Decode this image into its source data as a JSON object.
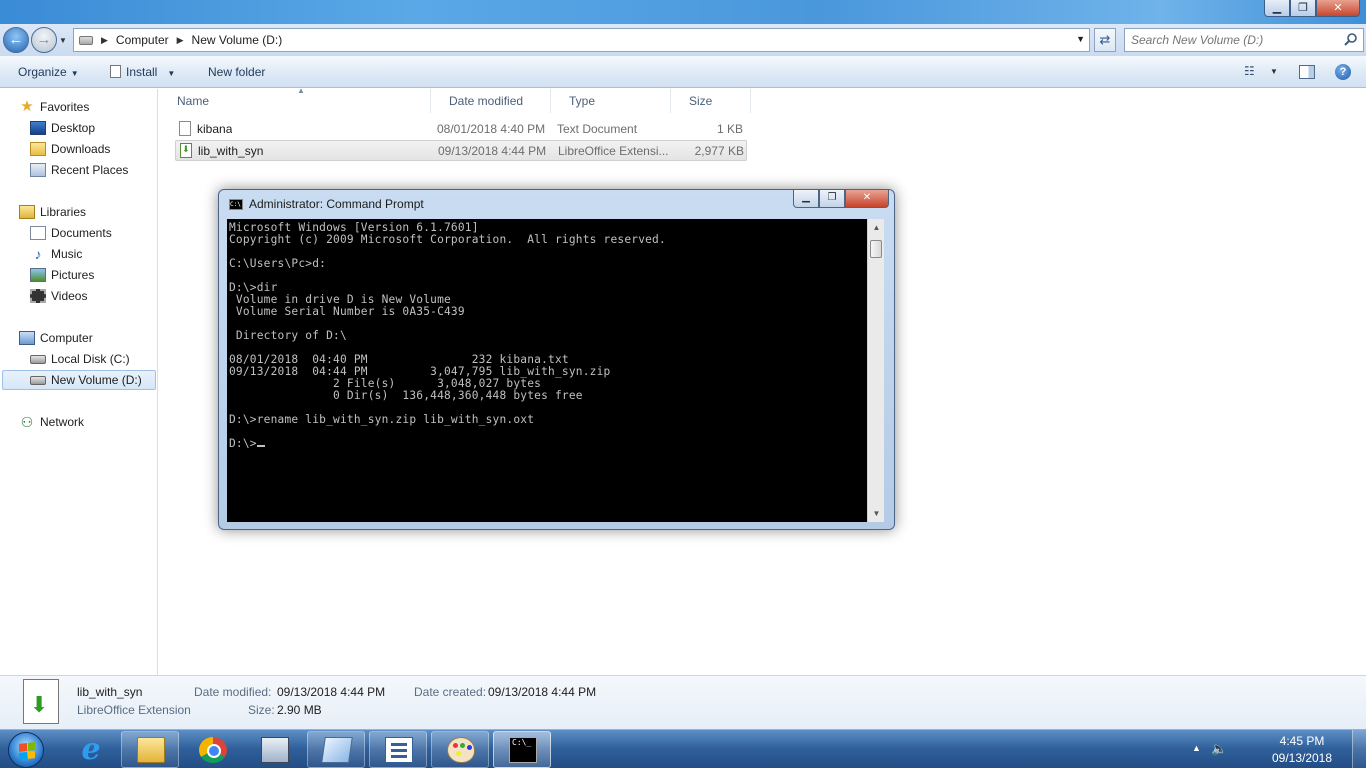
{
  "window": {
    "minimize_label": "▁",
    "maximize_label": "❐",
    "close_label": "✕"
  },
  "address": {
    "crumbs": [
      "Computer",
      "New Volume (D:)"
    ],
    "search_placeholder": "Search New Volume (D:)"
  },
  "toolbar": {
    "organize": "Organize",
    "install": "Install",
    "new_folder": "New folder"
  },
  "navigation": {
    "favorites": "Favorites",
    "desktop": "Desktop",
    "downloads": "Downloads",
    "recent_places": "Recent Places",
    "libraries": "Libraries",
    "documents": "Documents",
    "music": "Music",
    "pictures": "Pictures",
    "videos": "Videos",
    "computer": "Computer",
    "local_disk": "Local Disk (C:)",
    "new_volume": "New Volume (D:)",
    "network": "Network"
  },
  "columns": {
    "name": "Name",
    "date_modified": "Date modified",
    "type": "Type",
    "size": "Size"
  },
  "files": [
    {
      "name": "kibana",
      "date": "08/01/2018 4:40 PM",
      "type": "Text Document",
      "size": "1 KB"
    },
    {
      "name": "lib_with_syn",
      "date": "09/13/2018 4:44 PM",
      "type": "LibreOffice Extensi...",
      "size": "2,977 KB"
    }
  ],
  "cmd": {
    "title": "Administrator: Command Prompt",
    "icon_text": "C:\\",
    "lines": [
      "Microsoft Windows [Version 6.1.7601]",
      "Copyright (c) 2009 Microsoft Corporation.  All rights reserved.",
      "",
      "C:\\Users\\Pc>d:",
      "",
      "D:\\>dir",
      " Volume in drive D is New Volume",
      " Volume Serial Number is 0A35-C439",
      "",
      " Directory of D:\\",
      "",
      "08/01/2018  04:40 PM               232 kibana.txt",
      "09/13/2018  04:44 PM         3,047,795 lib_with_syn.zip",
      "               2 File(s)      3,048,027 bytes",
      "               0 Dir(s)  136,448,360,448 bytes free",
      "",
      "D:\\>rename lib_with_syn.zip lib_with_syn.oxt",
      "",
      "D:\\>"
    ]
  },
  "details": {
    "name": "lib_with_syn",
    "type": "LibreOffice Extension",
    "date_modified_label": "Date modified:",
    "date_modified": "09/13/2018 4:44 PM",
    "date_created_label": "Date created:",
    "date_created": "09/13/2018 4:44 PM",
    "size_label": "Size:",
    "size": "2.90 MB"
  },
  "taskbar": {
    "time": "4:45 PM",
    "date": "09/13/2018",
    "cmd_icon_text": "C:\\_"
  },
  "colors": {
    "taskbar": "#2f5f9a",
    "console_bg": "#000000",
    "console_fg": "#c0c0c0",
    "selection": "#d6e6f7"
  }
}
